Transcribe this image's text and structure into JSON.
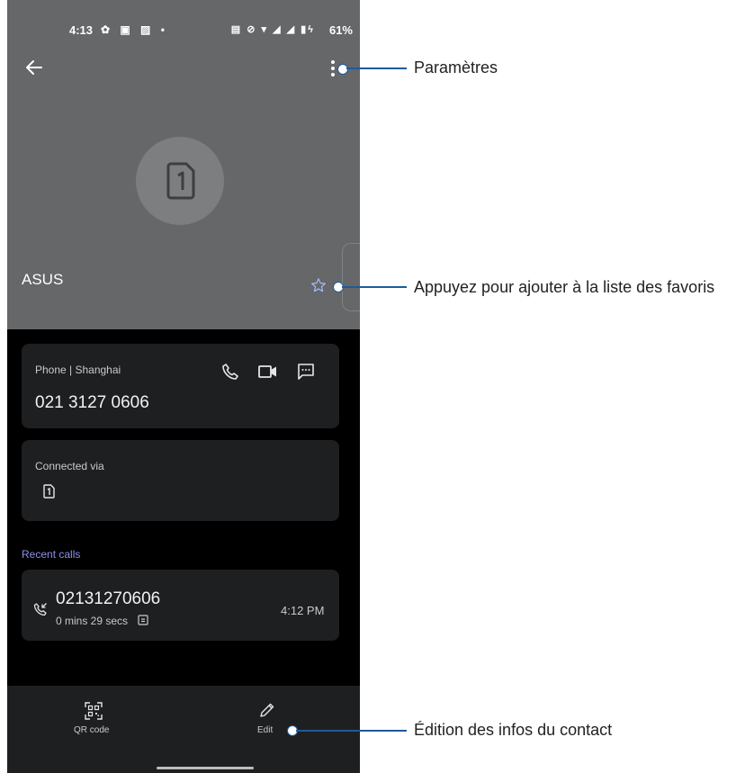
{
  "status_bar": {
    "time": "4:13",
    "battery": "61%"
  },
  "contact": {
    "name": "ASUS"
  },
  "phone_card": {
    "label": "Phone | Shanghai",
    "number": "021 3127 0606"
  },
  "connected_card": {
    "label": "Connected via"
  },
  "recent_calls": {
    "title": "Recent calls",
    "items": [
      {
        "number": "02131270606",
        "duration": "0 mins 29 secs",
        "time": "4:12 PM"
      }
    ]
  },
  "bottom_bar": {
    "qr_label": "QR code",
    "edit_label": "Edit"
  },
  "annotations": {
    "settings": "Paramètres",
    "favorite": "Appuyez pour ajouter à la liste des favoris",
    "edit": "Édition des infos du contact"
  },
  "colors": {
    "header": "#656769",
    "accent": "#8b8ff0",
    "callout": "#1e5a9c",
    "card": "#1e1f21"
  }
}
